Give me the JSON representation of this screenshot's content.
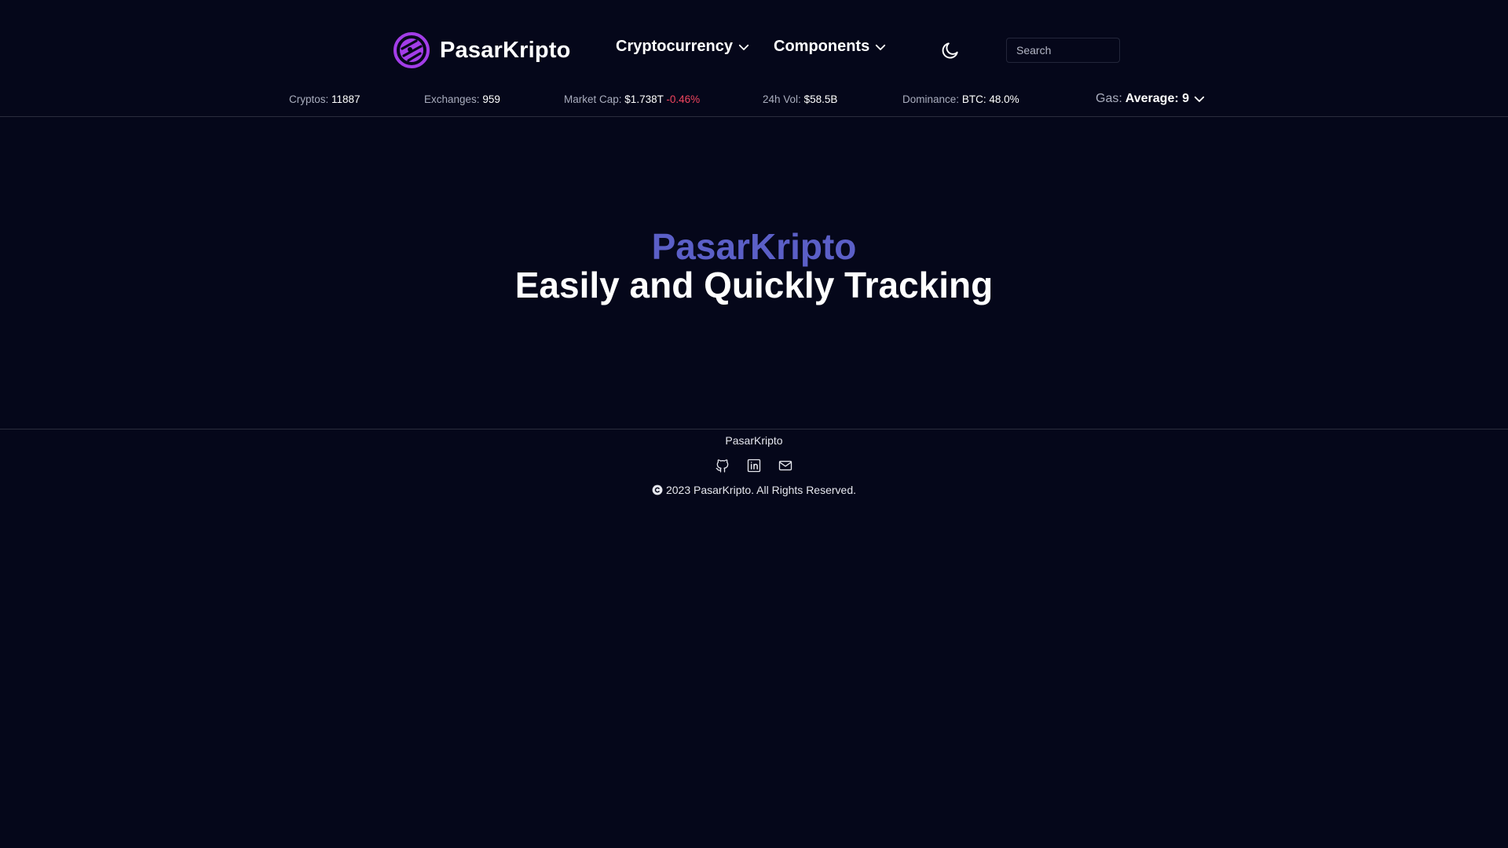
{
  "header": {
    "brand": "PasarKripto",
    "nav": [
      {
        "label": "Cryptocurrency"
      },
      {
        "label": "Components"
      }
    ],
    "theme_icon": "moon-icon",
    "search": {
      "placeholder": "Search",
      "value": ""
    }
  },
  "stats": {
    "cryptos": {
      "label": "Cryptos:",
      "value": "11887"
    },
    "exchanges": {
      "label": "Exchanges:",
      "value": "959"
    },
    "market_cap": {
      "label": "Market Cap:",
      "value": "$1.738T",
      "change": "-0.46%"
    },
    "volume": {
      "label": "24h Vol:",
      "value": "$58.5B"
    },
    "dominance": {
      "label": "Dominance:",
      "value": "BTC: 48.0%"
    },
    "gas": {
      "label": "Gas:",
      "value": "Average: 9"
    }
  },
  "hero": {
    "brand": "PasarKripto",
    "tagline": "Easily and Quickly Tracking"
  },
  "footer": {
    "brand": "PasarKripto",
    "socials": [
      "github-icon",
      "linkedin-icon",
      "mail-icon"
    ],
    "copyright": "2023 PasarKripto. All Rights Reserved."
  },
  "colors": {
    "background": "#05071a",
    "accent": "#5b5fc7",
    "negative": "#f0445e",
    "logo": "#a33de8"
  }
}
